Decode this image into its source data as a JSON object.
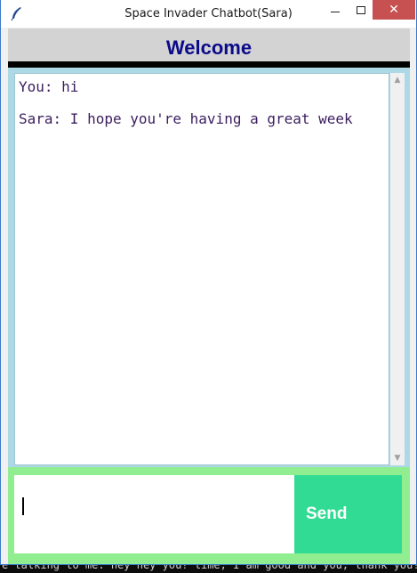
{
  "window": {
    "title": "Space Invader Chatbot(Sara)",
    "close_glyph": "✕"
  },
  "header": {
    "welcome": "Welcome"
  },
  "chat": {
    "messages": [
      {
        "text": "You: hi"
      },
      {
        "text": "Sara: I hope you're having a great week"
      }
    ]
  },
  "input": {
    "value": ""
  },
  "send_button": {
    "label": "Send"
  },
  "scrollbar": {
    "up_glyph": "▲",
    "down_glyph": "▼"
  },
  "background_terminal": {
    "text": "e talking to me.  hey hey you!    lime, I am good and you, thank you!!"
  },
  "colors": {
    "welcome_text": "#0b0b8a",
    "header_bg": "#d3d3d3",
    "chat_frame": "#add8e6",
    "input_frame": "#90ee90",
    "send_button": "#32db94",
    "close_button": "#c75050",
    "message_text": "#3b1d5e"
  }
}
